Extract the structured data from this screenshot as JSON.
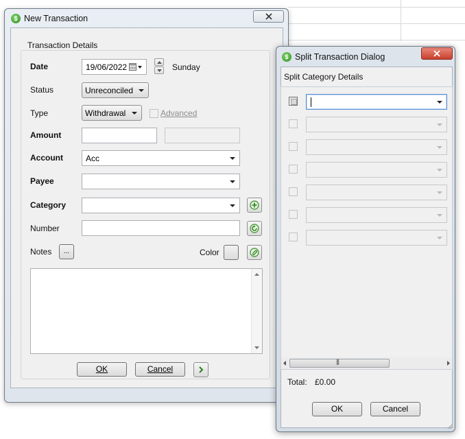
{
  "new_transaction": {
    "title": "New Transaction",
    "group_title": "Transaction Details",
    "date": {
      "label": "Date",
      "value": "19/06/2022",
      "weekday": "Sunday"
    },
    "status": {
      "label": "Status",
      "value": "Unreconciled"
    },
    "type": {
      "label": "Type",
      "value": "Withdrawal",
      "advanced_label": "Advanced"
    },
    "amount": {
      "label": "Amount",
      "value": ""
    },
    "account": {
      "label": "Account",
      "value": "Acc"
    },
    "payee": {
      "label": "Payee",
      "value": ""
    },
    "category": {
      "label": "Category",
      "value": ""
    },
    "number": {
      "label": "Number",
      "value": ""
    },
    "notes": {
      "label": "Notes",
      "button": "..."
    },
    "color_label": "Color",
    "ok_label": "OK",
    "cancel_label": "Cancel"
  },
  "split_dialog": {
    "title": "Split Transaction Dialog",
    "section_title": "Split Category Details",
    "rows": [
      {
        "category": "",
        "enabled": true
      },
      {
        "category": "",
        "enabled": false
      },
      {
        "category": "",
        "enabled": false
      },
      {
        "category": "",
        "enabled": false
      },
      {
        "category": "",
        "enabled": false
      },
      {
        "category": "",
        "enabled": false
      },
      {
        "category": "",
        "enabled": false
      }
    ],
    "total_label": "Total:",
    "total_value": "£0.00",
    "ok_label": "OK",
    "cancel_label": "Cancel"
  },
  "icons": {
    "app": "money-app-icon",
    "calendar": "calendar-icon",
    "add_category": "add-icon",
    "number_auto": "refresh-icon",
    "attachment": "paperclip-icon",
    "next": "chevron-right-icon"
  },
  "colors": {
    "accent_green": "#2f8f22",
    "close_red": "#c8402d"
  }
}
